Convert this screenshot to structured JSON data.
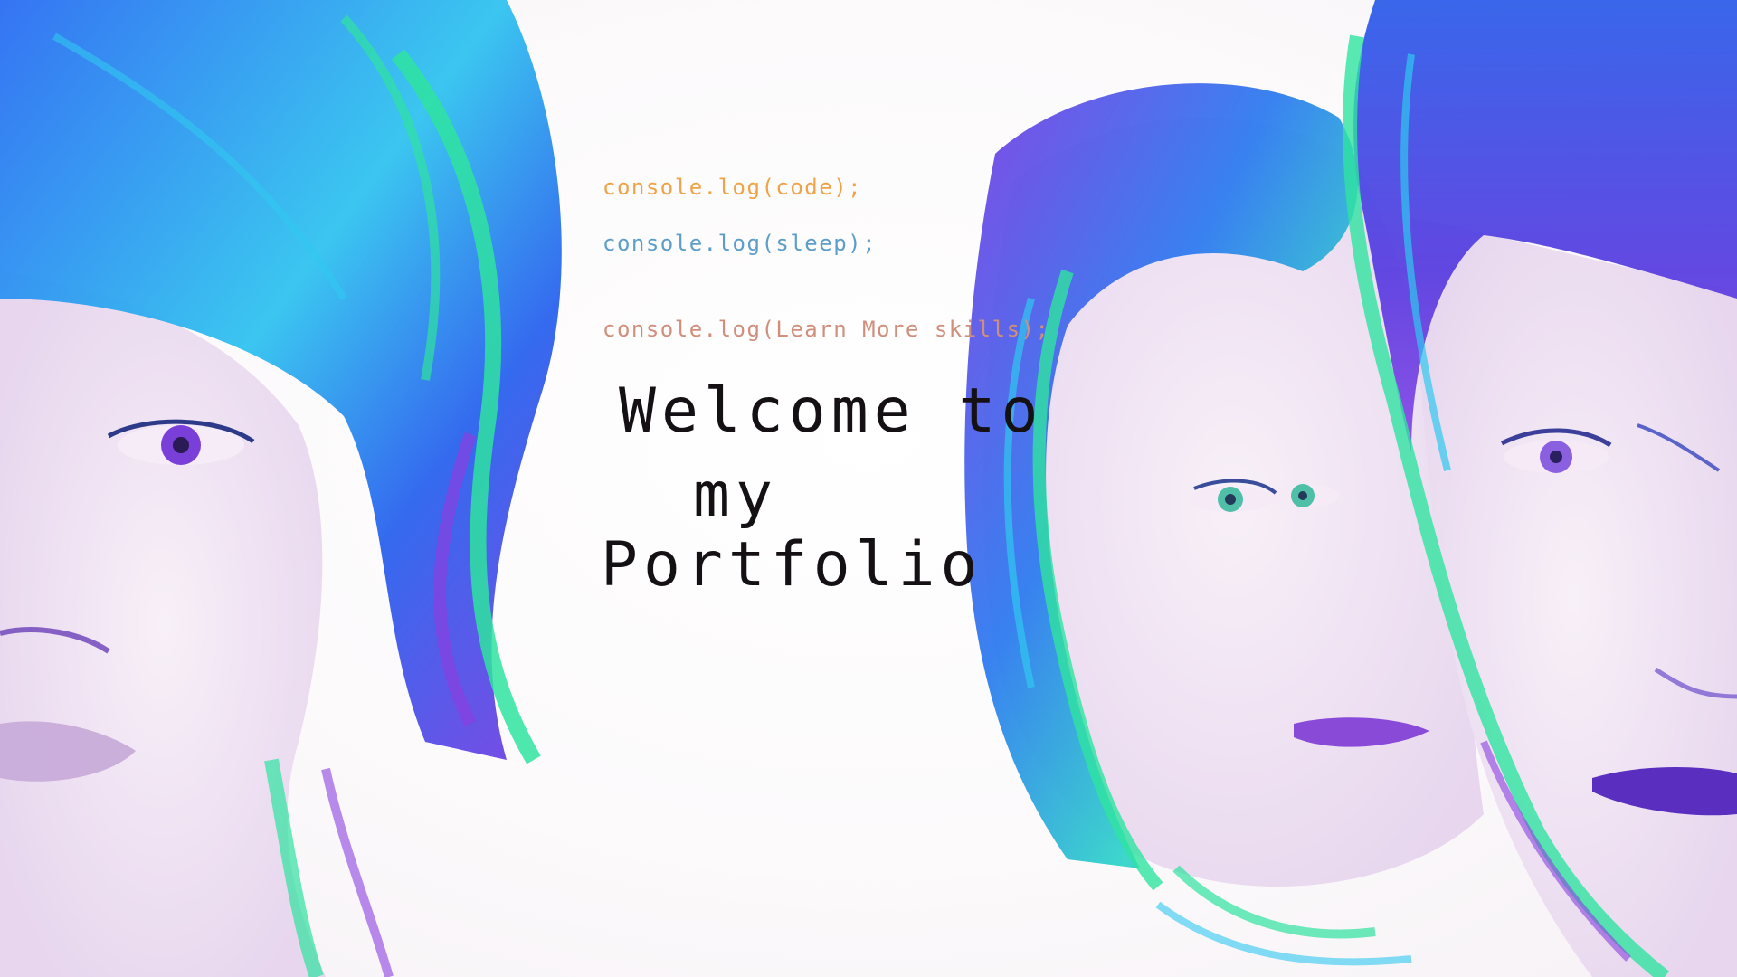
{
  "code_lines": [
    {
      "text": "console.log(code);",
      "color": "#f0a247"
    },
    {
      "text": "console.log(sleep);",
      "color": "#5c9ec9"
    },
    {
      "text": "console.log(Learn More skills);",
      "color": "#cf8f7c"
    }
  ],
  "headline": {
    "line1": "Welcome to",
    "line2": "my",
    "line3": "Portfolio"
  },
  "palette": {
    "blue": "#2a6bf2",
    "purple": "#8a3fe0",
    "green": "#2fe3a0",
    "cyan": "#30c8f0",
    "skin": "#f1e4f2"
  }
}
